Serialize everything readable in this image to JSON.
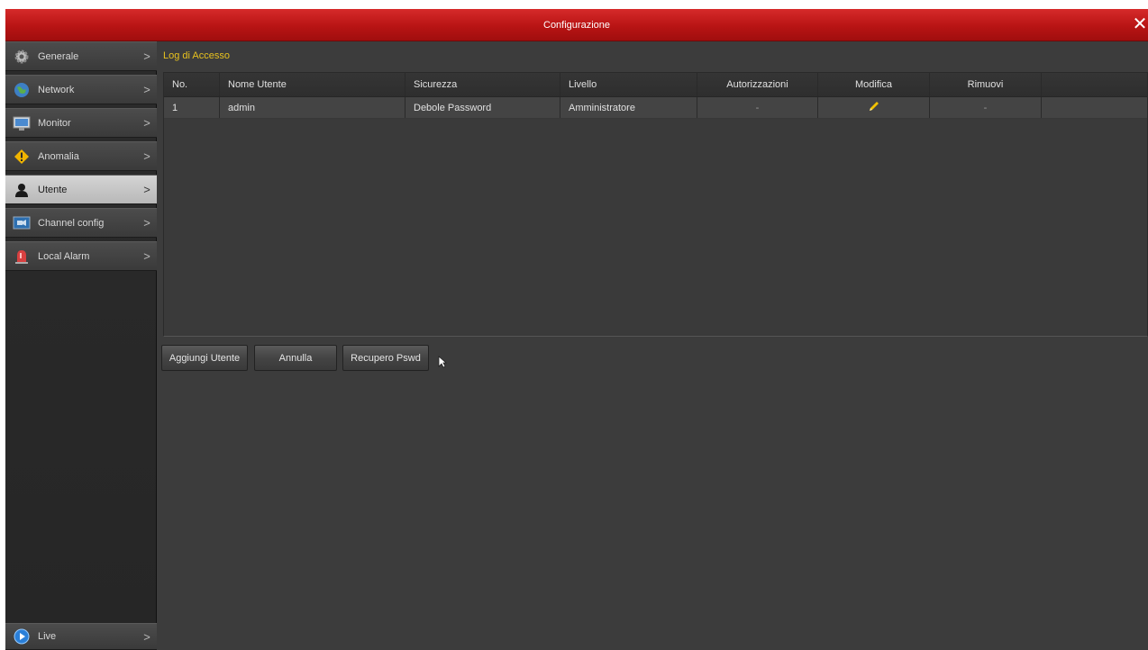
{
  "window": {
    "title": "Configurazione",
    "close_glyph": "✕"
  },
  "sidebar": {
    "items": [
      {
        "label": "Generale",
        "icon": "gear-icon",
        "active": false
      },
      {
        "label": "Network",
        "icon": "globe-icon",
        "active": false
      },
      {
        "label": "Monitor",
        "icon": "monitor-icon",
        "active": false
      },
      {
        "label": "Anomalia",
        "icon": "warning-icon",
        "active": false
      },
      {
        "label": "Utente",
        "icon": "user-icon",
        "active": true
      },
      {
        "label": "Channel config",
        "icon": "camera-channel-icon",
        "active": false
      },
      {
        "label": "Local Alarm",
        "icon": "alarm-siren-icon",
        "active": false
      }
    ],
    "live": {
      "label": "Live",
      "icon": "play-icon"
    },
    "arrow_glyph": ">"
  },
  "main": {
    "section_title": "Log di Accesso",
    "table": {
      "headers": [
        "No.",
        "Nome Utente",
        "Sicurezza",
        "Livello",
        "Autorizzazioni",
        "Modifica",
        "Rimuovi"
      ],
      "rows": [
        {
          "no": "1",
          "user": "admin",
          "security": "Debole Password",
          "level": "Amministratore",
          "permissions": "-",
          "edit_icon": "pencil-icon",
          "remove": "-"
        }
      ]
    },
    "buttons": {
      "add_user": "Aggiungi Utente",
      "cancel": "Annulla",
      "recover": "Recupero Pswd"
    }
  },
  "colors": {
    "titlebar": "#c41c1c",
    "section_title": "#e8c21e",
    "panel_bg": "#3c3c3c",
    "sidebar_bg": "#2b2b2b",
    "active_item": "#c8c8c8"
  }
}
